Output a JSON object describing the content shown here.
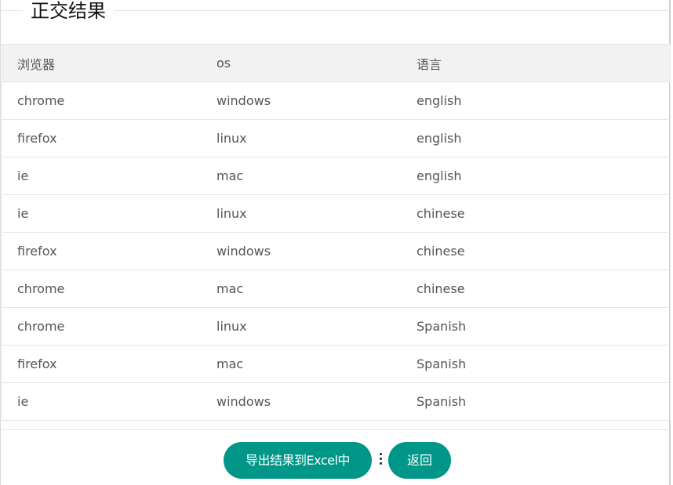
{
  "title": "正交结果",
  "table": {
    "headers": [
      "浏览器",
      "os",
      "语言"
    ],
    "rows": [
      [
        "chrome",
        "windows",
        "english"
      ],
      [
        "firefox",
        "linux",
        "english"
      ],
      [
        "ie",
        "mac",
        "english"
      ],
      [
        "ie",
        "linux",
        "chinese"
      ],
      [
        "firefox",
        "windows",
        "chinese"
      ],
      [
        "chrome",
        "mac",
        "chinese"
      ],
      [
        "chrome",
        "linux",
        "Spanish"
      ],
      [
        "firefox",
        "mac",
        "Spanish"
      ],
      [
        "ie",
        "windows",
        "Spanish"
      ]
    ]
  },
  "buttons": {
    "export_label": "导出结果到Excel中",
    "back_label": "返回"
  },
  "colors": {
    "button_bg": "#009688",
    "header_bg": "#f2f2f2"
  },
  "icons": {
    "more": "vertical-ellipsis-icon"
  }
}
